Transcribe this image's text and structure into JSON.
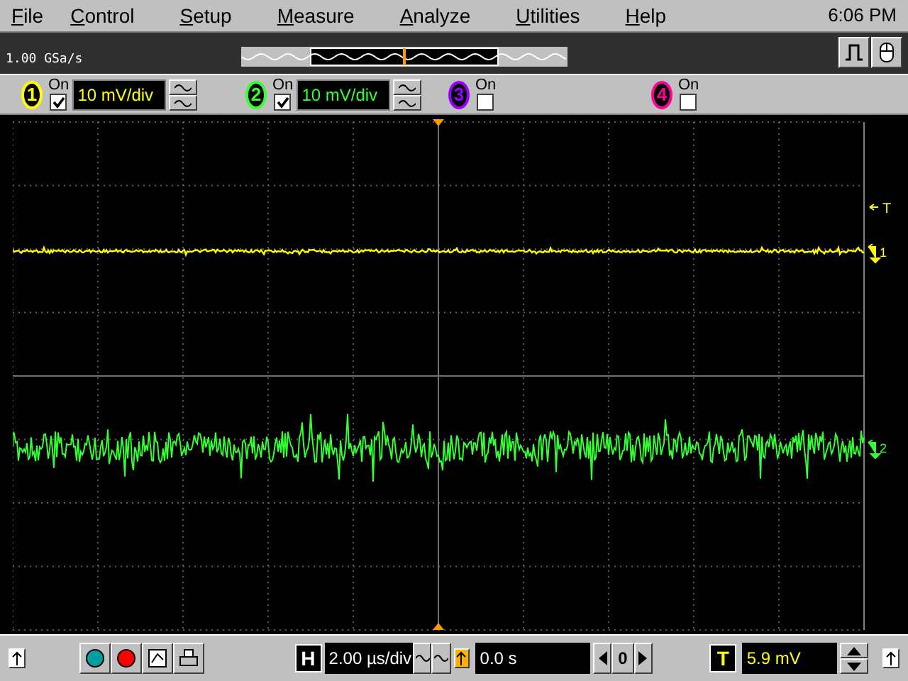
{
  "menu": [
    "File",
    "Control",
    "Setup",
    "Measure",
    "Analyze",
    "Utilities",
    "Help"
  ],
  "clock": "6:06 PM",
  "sample_rate": "1.00 GSa/s",
  "channels": [
    {
      "number": "1",
      "on_label": "On",
      "on": true,
      "scale": "10 mV/div",
      "color": "#ffff00"
    },
    {
      "number": "2",
      "on_label": "On",
      "on": true,
      "scale": "10 mV/div",
      "color": "#33ff33"
    },
    {
      "number": "3",
      "on_label": "On",
      "on": false,
      "color": "#9900ff"
    },
    {
      "number": "4",
      "on_label": "On",
      "on": false,
      "color": "#ff0099"
    }
  ],
  "markers": [
    {
      "label": "T",
      "kind": "trigger",
      "color": "#ffff00"
    },
    {
      "label": "1",
      "kind": "ground",
      "color": "#ffff00"
    },
    {
      "label": "2",
      "kind": "ground",
      "color": "#33ff33"
    }
  ],
  "bottom": {
    "h_label": "H",
    "timebase": "2.00 µs/div",
    "delay": "0.0 s",
    "zero": "0",
    "t_label": "T",
    "trigger_level": "5.9 mV"
  }
}
